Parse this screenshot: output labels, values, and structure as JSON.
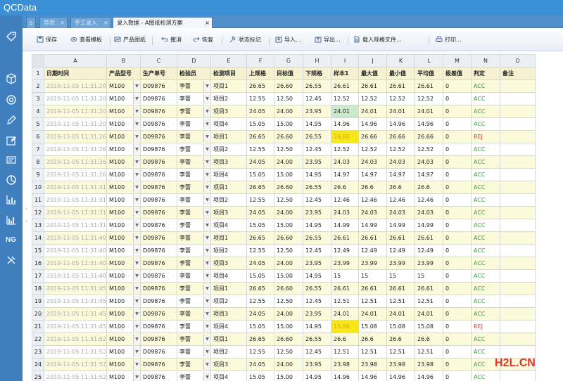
{
  "app": {
    "title": "QCData"
  },
  "tabs": [
    {
      "label": "首页",
      "active": false
    },
    {
      "label": "手工录入",
      "active": false
    },
    {
      "label": "录入数据 - A图纸检测方案",
      "active": true
    }
  ],
  "toolbar": [
    {
      "label": "保存",
      "icon": "save-icon"
    },
    {
      "label": "查看模板",
      "icon": "eye-icon"
    },
    {
      "label": "产品图纸",
      "icon": "drawing-icon"
    },
    {
      "label": "撤消",
      "icon": "undo-icon"
    },
    {
      "label": "恢复",
      "icon": "redo-icon"
    },
    {
      "label": "状态标记",
      "icon": "pin-icon"
    },
    {
      "label": "导入...",
      "icon": "import-icon"
    },
    {
      "label": "导出...",
      "icon": "export-icon"
    },
    {
      "label": "载入规格文件...",
      "icon": "spec-file-icon"
    },
    {
      "label": "打印...",
      "icon": "print-icon"
    }
  ],
  "sidebar_icons": [
    "tag-icon",
    "box-icon",
    "target-icon",
    "pencil-icon",
    "edit-icon",
    "form-icon",
    "pie-icon",
    "bar-chart-icon",
    "column-chart-icon",
    "ng-icon",
    "tools-icon"
  ],
  "sidebar_ng_label": "NG",
  "grid": {
    "columns": [
      "A",
      "B",
      "C",
      "D",
      "E",
      "F",
      "G",
      "H",
      "I",
      "J",
      "K",
      "L",
      "M",
      "N",
      "O"
    ],
    "headers": [
      "日期时间",
      "产品型号",
      "生产单号",
      "检验员",
      "检测项目",
      "上规格",
      "目标值",
      "下规格",
      "样本1",
      "最大值",
      "最小值",
      "平均值",
      "极差值",
      "判定",
      "备注"
    ],
    "rows": [
      {
        "n": "2",
        "date": "2019-11-05 11:31:20",
        "model": "M100",
        "order": "D09876",
        "inspector": "李蕾",
        "item": "项目1",
        "usl": "26.65",
        "target": "26.60",
        "lsl": "26.55",
        "s1": "26.61",
        "max": "26.61",
        "min": "26.61",
        "avg": "26.61",
        "range": "0",
        "judge": "ACC",
        "note": "",
        "hl": ""
      },
      {
        "n": "3",
        "date": "2019-11-05 11:31:20",
        "model": "M100",
        "order": "D09876",
        "inspector": "李蕾",
        "item": "项目2",
        "usl": "12.55",
        "target": "12.50",
        "lsl": "12.45",
        "s1": "12.52",
        "max": "12.52",
        "min": "12.52",
        "avg": "12.52",
        "range": "0",
        "judge": "ACC",
        "note": "",
        "hl": ""
      },
      {
        "n": "4",
        "date": "2019-11-05 11:31:20",
        "model": "M100",
        "order": "D09876",
        "inspector": "李蕾",
        "item": "项目3",
        "usl": "24.05",
        "target": "24.00",
        "lsl": "23.95",
        "s1": "24.01",
        "max": "24.01",
        "min": "24.01",
        "avg": "24.01",
        "range": "0",
        "judge": "ACC",
        "note": "",
        "hl": "green"
      },
      {
        "n": "5",
        "date": "2019-11-05 11:31:20",
        "model": "M100",
        "order": "D09876",
        "inspector": "李蕾",
        "item": "项目4",
        "usl": "15.05",
        "target": "15.00",
        "lsl": "14.95",
        "s1": "14.96",
        "max": "14.96",
        "min": "14.96",
        "avg": "14.96",
        "range": "0",
        "judge": "ACC",
        "note": "",
        "hl": ""
      },
      {
        "n": "6",
        "date": "2019-11-05 11:31:26",
        "model": "M100",
        "order": "D09876",
        "inspector": "李蕾",
        "item": "项目1",
        "usl": "26.65",
        "target": "26.60",
        "lsl": "26.55",
        "s1": "26.66",
        "max": "26.66",
        "min": "26.66",
        "avg": "26.66",
        "range": "0",
        "judge": "REJ",
        "note": "",
        "hl": "yellow"
      },
      {
        "n": "7",
        "date": "2019-11-05 11:31:26",
        "model": "M100",
        "order": "D09876",
        "inspector": "李蕾",
        "item": "项目2",
        "usl": "12.55",
        "target": "12.50",
        "lsl": "12.45",
        "s1": "12.52",
        "max": "12.52",
        "min": "12.52",
        "avg": "12.52",
        "range": "0",
        "judge": "ACC",
        "note": "",
        "hl": ""
      },
      {
        "n": "8",
        "date": "2019-11-05 11:31:26",
        "model": "M100",
        "order": "D09876",
        "inspector": "李蕾",
        "item": "项目3",
        "usl": "24.05",
        "target": "24.00",
        "lsl": "23.95",
        "s1": "24.03",
        "max": "24.03",
        "min": "24.03",
        "avg": "24.03",
        "range": "0",
        "judge": "ACC",
        "note": "",
        "hl": ""
      },
      {
        "n": "9",
        "date": "2019-11-05 11:31:26",
        "model": "M100",
        "order": "D09876",
        "inspector": "李蕾",
        "item": "项目4",
        "usl": "15.05",
        "target": "15.00",
        "lsl": "14.95",
        "s1": "14.97",
        "max": "14.97",
        "min": "14.97",
        "avg": "14.97",
        "range": "0",
        "judge": "ACC",
        "note": "",
        "hl": ""
      },
      {
        "n": "10",
        "date": "2019-11-05 11:31:31",
        "model": "M100",
        "order": "D09876",
        "inspector": "李蕾",
        "item": "项目1",
        "usl": "26.65",
        "target": "26.60",
        "lsl": "26.55",
        "s1": "26.6",
        "max": "26.6",
        "min": "26.6",
        "avg": "26.6",
        "range": "0",
        "judge": "ACC",
        "note": "",
        "hl": ""
      },
      {
        "n": "11",
        "date": "2019-11-05 11:31:31",
        "model": "M100",
        "order": "D09876",
        "inspector": "李蕾",
        "item": "项目2",
        "usl": "12.55",
        "target": "12.50",
        "lsl": "12.45",
        "s1": "12.46",
        "max": "12.46",
        "min": "12.46",
        "avg": "12.46",
        "range": "0",
        "judge": "ACC",
        "note": "",
        "hl": ""
      },
      {
        "n": "12",
        "date": "2019-11-05 11:31:31",
        "model": "M100",
        "order": "D09876",
        "inspector": "李蕾",
        "item": "项目3",
        "usl": "24.05",
        "target": "24.00",
        "lsl": "23.95",
        "s1": "24.03",
        "max": "24.03",
        "min": "24.03",
        "avg": "24.03",
        "range": "0",
        "judge": "ACC",
        "note": "",
        "hl": ""
      },
      {
        "n": "13",
        "date": "2019-11-05 11:31:31",
        "model": "M100",
        "order": "D09876",
        "inspector": "李蕾",
        "item": "项目4",
        "usl": "15.05",
        "target": "15.00",
        "lsl": "14.95",
        "s1": "14.99",
        "max": "14.99",
        "min": "14.99",
        "avg": "14.99",
        "range": "0",
        "judge": "ACC",
        "note": "",
        "hl": ""
      },
      {
        "n": "14",
        "date": "2019-11-05 11:31:40",
        "model": "M100",
        "order": "D09876",
        "inspector": "李蕾",
        "item": "项目1",
        "usl": "26.65",
        "target": "26.60",
        "lsl": "26.55",
        "s1": "26.61",
        "max": "26.61",
        "min": "26.61",
        "avg": "26.61",
        "range": "0",
        "judge": "ACC",
        "note": "",
        "hl": ""
      },
      {
        "n": "15",
        "date": "2019-11-05 11:31:40",
        "model": "M100",
        "order": "D09876",
        "inspector": "李蕾",
        "item": "项目2",
        "usl": "12.55",
        "target": "12.50",
        "lsl": "12.45",
        "s1": "12.49",
        "max": "12.49",
        "min": "12.49",
        "avg": "12.49",
        "range": "0",
        "judge": "ACC",
        "note": "",
        "hl": ""
      },
      {
        "n": "16",
        "date": "2019-11-05 11:31:40",
        "model": "M100",
        "order": "D09876",
        "inspector": "李蕾",
        "item": "项目3",
        "usl": "24.05",
        "target": "24.00",
        "lsl": "23.95",
        "s1": "23.99",
        "max": "23.99",
        "min": "23.99",
        "avg": "23.99",
        "range": "0",
        "judge": "ACC",
        "note": "",
        "hl": ""
      },
      {
        "n": "17",
        "date": "2019-11-05 11:31:40",
        "model": "M100",
        "order": "D09876",
        "inspector": "李蕾",
        "item": "项目4",
        "usl": "15.05",
        "target": "15.00",
        "lsl": "14.95",
        "s1": "15",
        "max": "15",
        "min": "15",
        "avg": "15",
        "range": "0",
        "judge": "ACC",
        "note": "",
        "hl": ""
      },
      {
        "n": "18",
        "date": "2019-11-05 11:31:45",
        "model": "M100",
        "order": "D09876",
        "inspector": "李蕾",
        "item": "项目1",
        "usl": "26.65",
        "target": "26.60",
        "lsl": "26.55",
        "s1": "26.61",
        "max": "26.61",
        "min": "26.61",
        "avg": "26.61",
        "range": "0",
        "judge": "ACC",
        "note": "",
        "hl": ""
      },
      {
        "n": "19",
        "date": "2019-11-05 11:31:45",
        "model": "M100",
        "order": "D09876",
        "inspector": "李蕾",
        "item": "项目2",
        "usl": "12.55",
        "target": "12.50",
        "lsl": "12.45",
        "s1": "12.51",
        "max": "12.51",
        "min": "12.51",
        "avg": "12.51",
        "range": "0",
        "judge": "ACC",
        "note": "",
        "hl": ""
      },
      {
        "n": "20",
        "date": "2019-11-05 11:31:45",
        "model": "M100",
        "order": "D09876",
        "inspector": "李蕾",
        "item": "项目3",
        "usl": "24.05",
        "target": "24.00",
        "lsl": "23.95",
        "s1": "24.01",
        "max": "24.01",
        "min": "24.01",
        "avg": "24.01",
        "range": "0",
        "judge": "ACC",
        "note": "",
        "hl": ""
      },
      {
        "n": "21",
        "date": "2019-11-05 11:31:45",
        "model": "M100",
        "order": "D09876",
        "inspector": "李蕾",
        "item": "项目4",
        "usl": "15.05",
        "target": "15.00",
        "lsl": "14.95",
        "s1": "15.08",
        "max": "15.08",
        "min": "15.08",
        "avg": "15.08",
        "range": "0",
        "judge": "REJ",
        "note": "",
        "hl": "yellow"
      },
      {
        "n": "22",
        "date": "2019-11-05 11:31:52",
        "model": "M100",
        "order": "D09876",
        "inspector": "李蕾",
        "item": "项目1",
        "usl": "26.65",
        "target": "26.60",
        "lsl": "26.55",
        "s1": "26.6",
        "max": "26.6",
        "min": "26.6",
        "avg": "26.6",
        "range": "0",
        "judge": "ACC",
        "note": "",
        "hl": ""
      },
      {
        "n": "23",
        "date": "2019-11-05 11:31:52",
        "model": "M100",
        "order": "D09876",
        "inspector": "李蕾",
        "item": "项目2",
        "usl": "12.55",
        "target": "12.50",
        "lsl": "12.45",
        "s1": "12.51",
        "max": "12.51",
        "min": "12.51",
        "avg": "12.51",
        "range": "0",
        "judge": "ACC",
        "note": "",
        "hl": ""
      },
      {
        "n": "24",
        "date": "2019-11-05 11:31:52",
        "model": "M100",
        "order": "D09876",
        "inspector": "李蕾",
        "item": "项目3",
        "usl": "24.05",
        "target": "24.00",
        "lsl": "23.95",
        "s1": "23.98",
        "max": "23.98",
        "min": "23.98",
        "avg": "23.98",
        "range": "0",
        "judge": "ACC",
        "note": "",
        "hl": ""
      },
      {
        "n": "25",
        "date": "2019-11-05 11:31:52",
        "model": "M100",
        "order": "D09876",
        "inspector": "李蕾",
        "item": "项目4",
        "usl": "15.05",
        "target": "15.00",
        "lsl": "14.95",
        "s1": "14.96",
        "max": "14.96",
        "min": "14.96",
        "avg": "14.96",
        "range": "0",
        "judge": "ACC",
        "note": "",
        "hl": ""
      }
    ]
  },
  "watermark": {
    "text": "H2L",
    "suffix": "CN",
    "dot": "."
  },
  "colors": {
    "accent": "#3a8fd6",
    "sidebar": "#3f7fbd",
    "acc": "#3aa33a",
    "rej": "#d33a3a",
    "highlight": "#f7e619"
  }
}
